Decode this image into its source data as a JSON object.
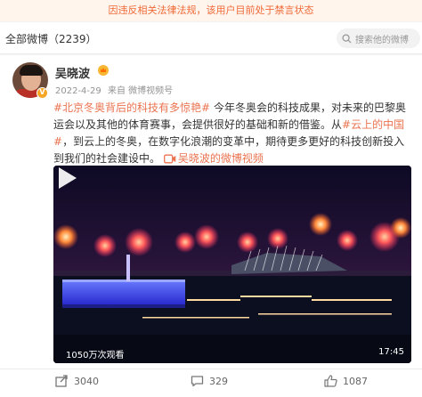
{
  "banner": {
    "text": "因违反相关法律法规，该用户目前处于禁言状态"
  },
  "tabbar": {
    "title": "全部微博（2239）",
    "search_placeholder": "搜索他的微博"
  },
  "post": {
    "author": "吴晓波",
    "verified_badge": "V",
    "date": "2022-4-29",
    "source": "来自 微博视频号",
    "text": {
      "topic1": "#北京冬奥背后的科技有多惊艳#",
      "part1": " 今年冬奥会的科技成果，对未来的巴黎奥运会以及其他的体育赛事，会提供很好的基础和新的借鉴。从",
      "topic2": "#云上的中国#",
      "part2": "，到云上的冬奥，在数字化浪潮的变革中，期待更多更好的科技创新投入到我们的社会建设中。",
      "video_link": "吴晓波的微博视频"
    },
    "video": {
      "views": "1050万次观看",
      "duration": "17:45"
    },
    "actions": {
      "repost": "3040",
      "comment": "329",
      "like": "1087"
    }
  },
  "colors": {
    "accent": "#eb7350",
    "banner_text": "#f06a38",
    "banner_bg": "#fff5ed",
    "vip_gold": "#f7b733"
  },
  "icons": [
    "search-icon",
    "crown-icon",
    "verified-icon",
    "video-camera-icon",
    "play-icon",
    "repost-icon",
    "comment-icon",
    "like-icon"
  ]
}
